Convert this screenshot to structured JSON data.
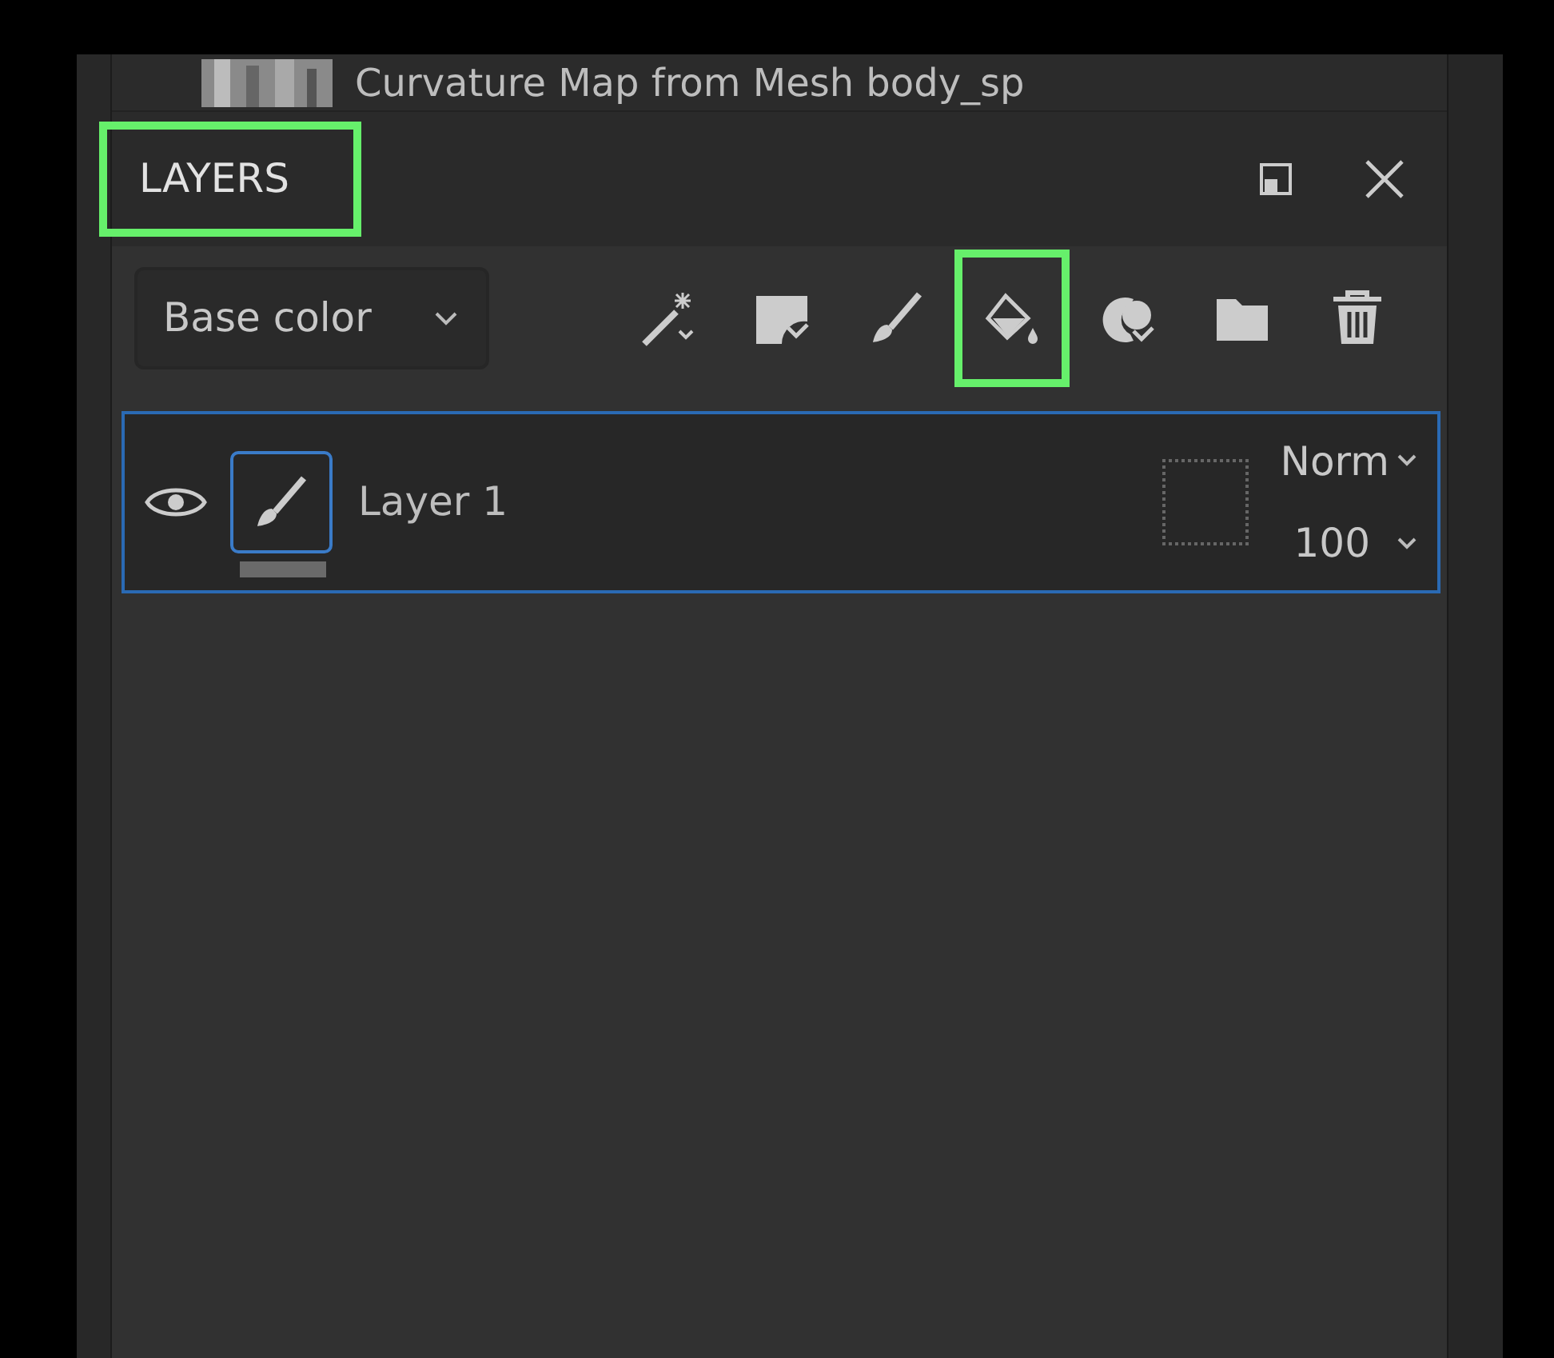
{
  "top_item": {
    "label": "Curvature Map from Mesh body_sp"
  },
  "panel": {
    "title": "LAYERS",
    "title_highlighted": true
  },
  "channel_select": {
    "value": "Base color"
  },
  "tools": [
    {
      "kind": "wand",
      "highlighted": false
    },
    {
      "kind": "mask",
      "highlighted": false
    },
    {
      "kind": "brush",
      "highlighted": false
    },
    {
      "kind": "fill",
      "highlighted": true
    },
    {
      "kind": "effect",
      "highlighted": false
    },
    {
      "kind": "folder",
      "highlighted": false
    },
    {
      "kind": "trash",
      "highlighted": false
    }
  ],
  "layers": [
    {
      "name": "Layer 1",
      "visible": true,
      "selected": true,
      "blend_mode": "Norm",
      "opacity": "100"
    }
  ]
}
